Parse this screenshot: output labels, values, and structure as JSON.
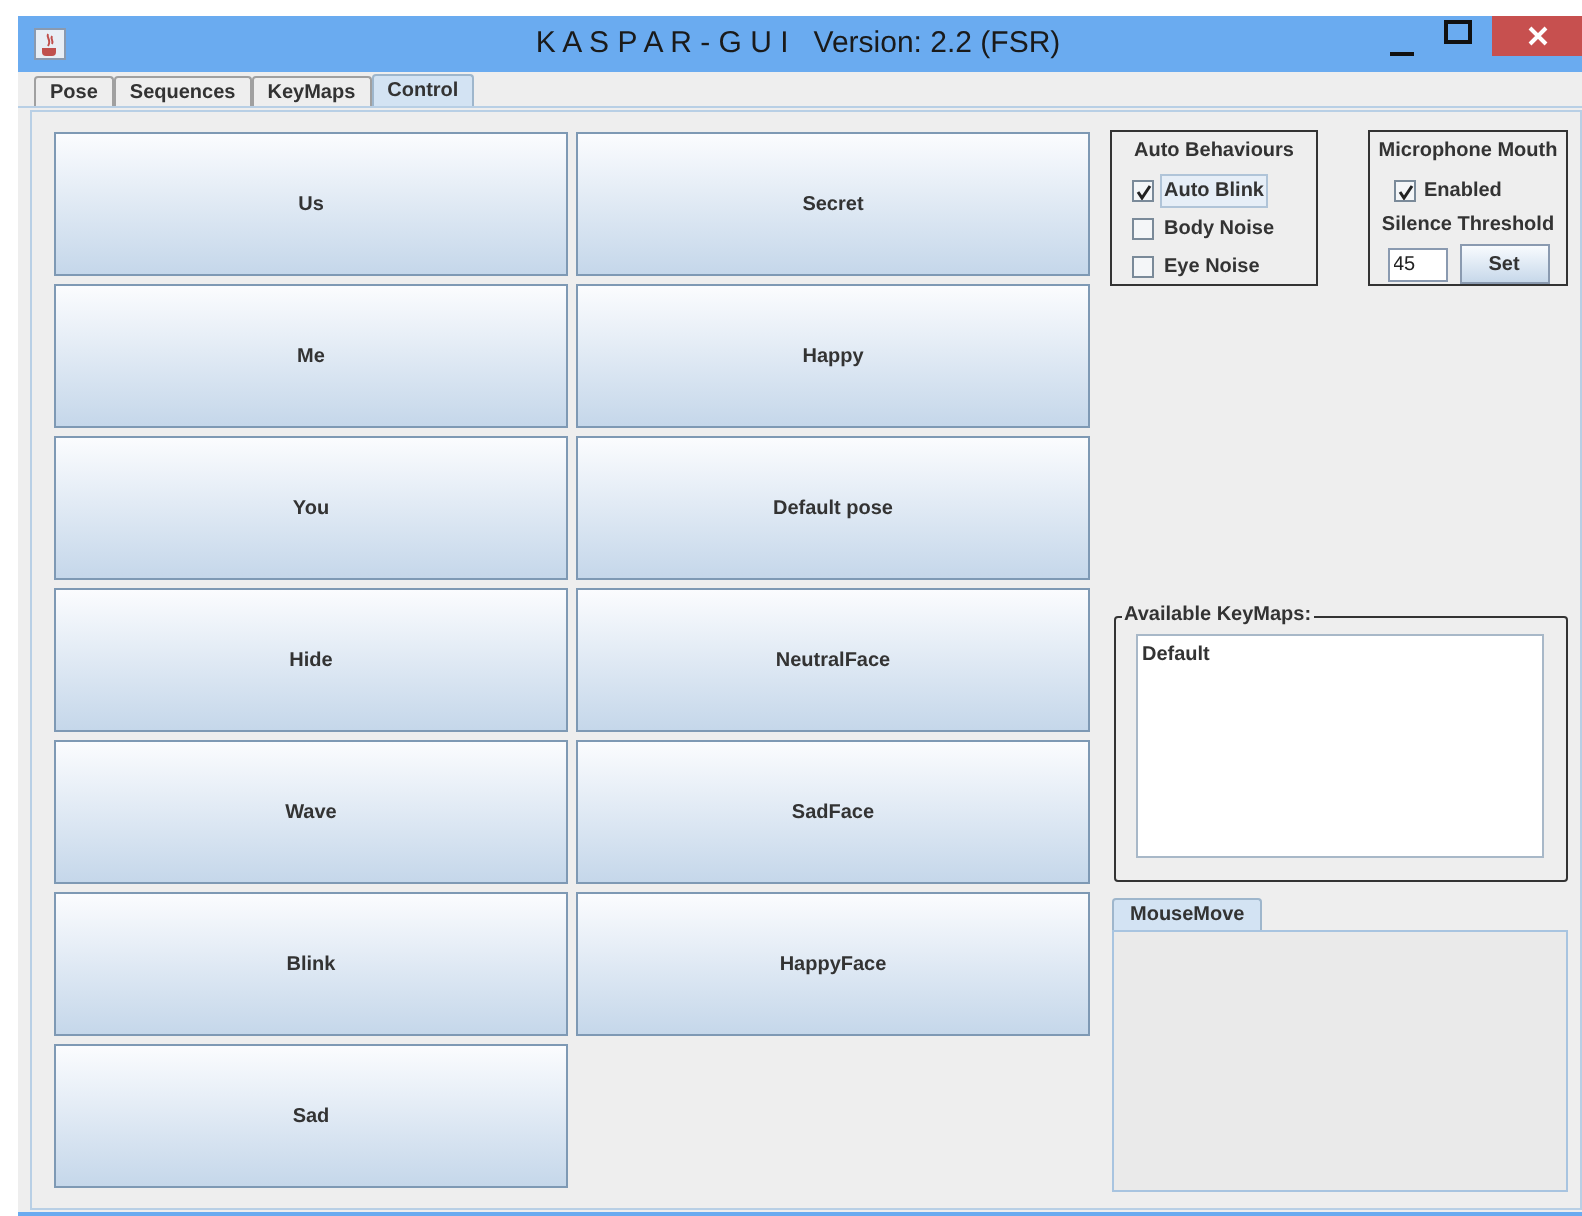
{
  "window": {
    "title": "K A S P A R - G U I   Version: 2.2 (FSR)"
  },
  "tabs": [
    {
      "label": "Pose",
      "selected": false
    },
    {
      "label": "Sequences",
      "selected": false
    },
    {
      "label": "KeyMaps",
      "selected": false
    },
    {
      "label": "Control",
      "selected": true
    }
  ],
  "buttons": [
    "Us",
    "Secret",
    "Me",
    "Happy",
    "You",
    "Default pose",
    "Hide",
    "NeutralFace",
    "Wave",
    "SadFace",
    "Blink",
    "HappyFace",
    "Sad"
  ],
  "auto_behaviours": {
    "title": "Auto Behaviours",
    "options": [
      {
        "label": "Auto Blink",
        "checked": true,
        "focused": true
      },
      {
        "label": "Body Noise",
        "checked": false,
        "focused": false
      },
      {
        "label": "Eye Noise",
        "checked": false,
        "focused": false
      }
    ]
  },
  "microphone_mouth": {
    "title": "Microphone Mouth",
    "enabled": {
      "label": "Enabled",
      "checked": true
    },
    "threshold_label": "Silence Threshold",
    "threshold_value": "45",
    "set_button": "Set"
  },
  "keymaps": {
    "title": "Available KeyMaps:",
    "items": [
      {
        "label": "Default",
        "selected": false
      }
    ]
  },
  "mouse_panel": {
    "tabs": [
      {
        "label": "MouseMove",
        "selected": true
      }
    ]
  }
}
